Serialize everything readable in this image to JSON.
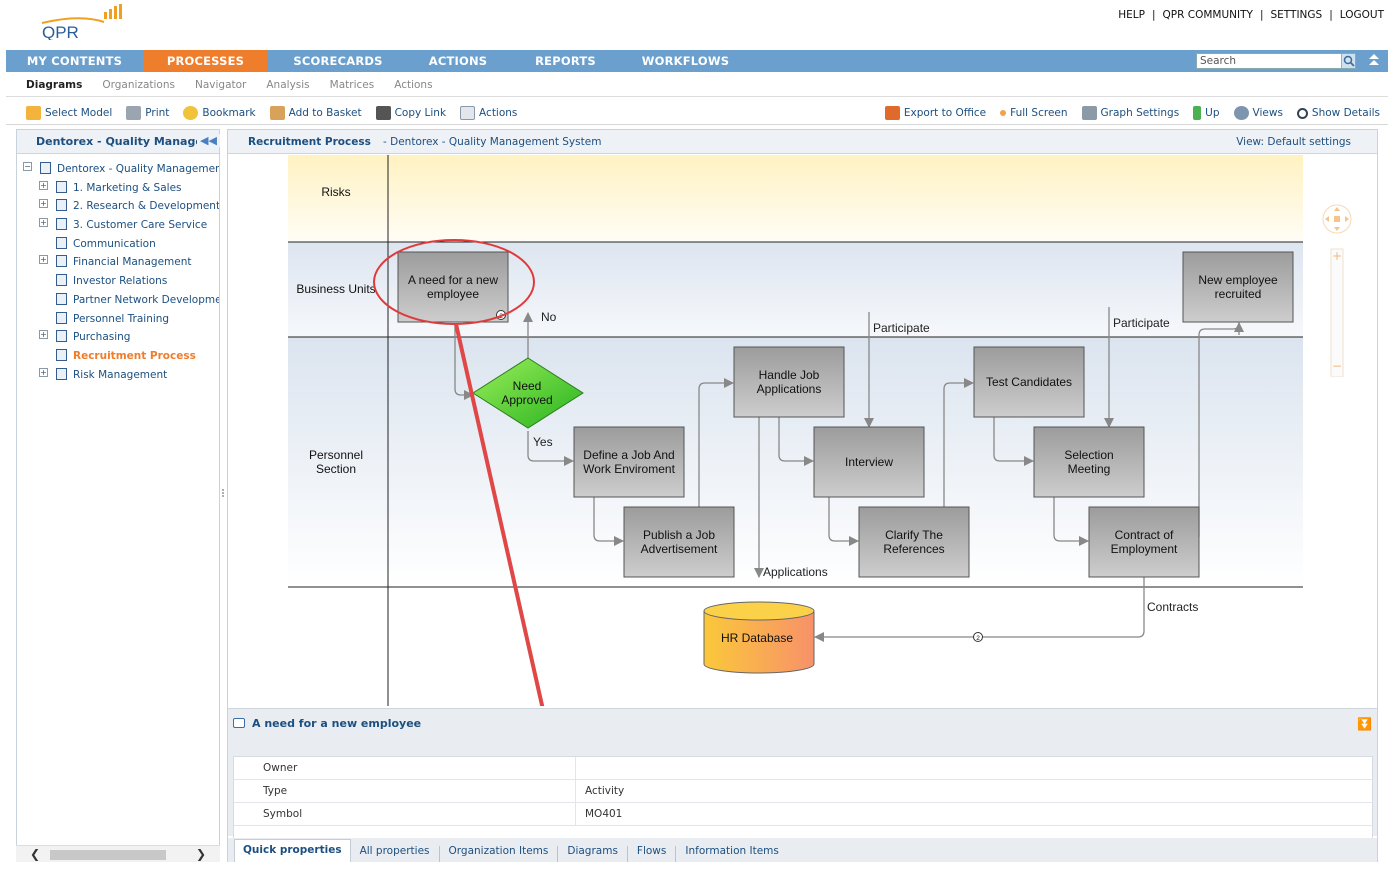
{
  "header": {
    "logo_text": "QPR",
    "links": [
      "HELP",
      "QPR COMMUNITY",
      "SETTINGS",
      "LOGOUT"
    ]
  },
  "main_nav": {
    "items": [
      {
        "label": "MY CONTENTS",
        "active": false
      },
      {
        "label": "PROCESSES",
        "active": true
      },
      {
        "label": "SCORECARDS",
        "active": false
      },
      {
        "label": "ACTIONS",
        "active": false
      },
      {
        "label": "REPORTS",
        "active": false
      },
      {
        "label": "WORKFLOWS",
        "active": false
      }
    ],
    "search_placeholder": "Search",
    "accent_color": "#ee7d2c",
    "bar_color": "#6b9fcd"
  },
  "sub_nav": {
    "items": [
      "Diagrams",
      "Organizations",
      "Navigator",
      "Analysis",
      "Matrices",
      "Actions"
    ],
    "active": "Diagrams"
  },
  "toolbar": {
    "left": [
      "Select Model",
      "Print",
      "Bookmark",
      "Add to Basket",
      "Copy Link",
      "Actions"
    ],
    "right": [
      "Export to Office",
      "Full Screen",
      "Graph Settings",
      "Up",
      "Views",
      "Show Details"
    ]
  },
  "left_panel": {
    "title": "Dentorex - Quality Management S",
    "tree": [
      {
        "label": "Dentorex - Quality Management S",
        "level": 0,
        "expander": "−"
      },
      {
        "label": "1. Marketing & Sales",
        "level": 1,
        "expander": "+"
      },
      {
        "label": "2. Research & Development",
        "level": 1,
        "expander": "+"
      },
      {
        "label": "3. Customer Care Service",
        "level": 1,
        "expander": "+"
      },
      {
        "label": "Communication",
        "level": 1,
        "expander": ""
      },
      {
        "label": "Financial Management",
        "level": 1,
        "expander": "+"
      },
      {
        "label": "Investor Relations",
        "level": 1,
        "expander": ""
      },
      {
        "label": "Partner Network Development",
        "level": 1,
        "expander": ""
      },
      {
        "label": "Personnel Training",
        "level": 1,
        "expander": ""
      },
      {
        "label": "Purchasing",
        "level": 1,
        "expander": "+"
      },
      {
        "label": "Recruitment Process",
        "level": 1,
        "expander": "",
        "selected": true
      },
      {
        "label": "Risk Management",
        "level": 1,
        "expander": "+"
      }
    ]
  },
  "diagram_header": {
    "title": "Recruitment Process",
    "subtitle": "- Dentorex - Quality Management System",
    "view": "View: Default settings"
  },
  "diagram": {
    "lanes": [
      "Risks",
      "Business Units",
      "Personnel Section"
    ],
    "personnel_section_lines": [
      "Personnel",
      "Section"
    ],
    "activities": {
      "need": [
        "A need for a new",
        "employee"
      ],
      "recruited": [
        "New employee",
        "recruited"
      ],
      "handle": [
        "Handle Job",
        "Applications"
      ],
      "define": [
        "Define a Job And",
        "Work Enviroment"
      ],
      "publish": [
        "Publish a Job",
        "Advertisement"
      ],
      "interview": [
        "Interview"
      ],
      "clarify": [
        "Clarify The",
        "References"
      ],
      "test": [
        "Test Candidates"
      ],
      "selection": [
        "Selection",
        "Meeting"
      ],
      "contract": [
        "Contract of",
        "Employment"
      ]
    },
    "decision": [
      "Need",
      "Approved"
    ],
    "database": "HR Database",
    "flow_labels": {
      "no": "No",
      "yes": "Yes",
      "participate": "Participate",
      "applications": "Applications",
      "contracts": "Contracts"
    },
    "badge": "2"
  },
  "properties": {
    "title": "A need for a new employee",
    "rows": [
      {
        "key": "Owner",
        "value": ""
      },
      {
        "key": "Type",
        "value": "Activity"
      },
      {
        "key": "Symbol",
        "value": "MO401"
      }
    ],
    "tabs": [
      "Quick properties",
      "All properties",
      "Organization Items",
      "Diagrams",
      "Flows",
      "Information Items"
    ]
  }
}
